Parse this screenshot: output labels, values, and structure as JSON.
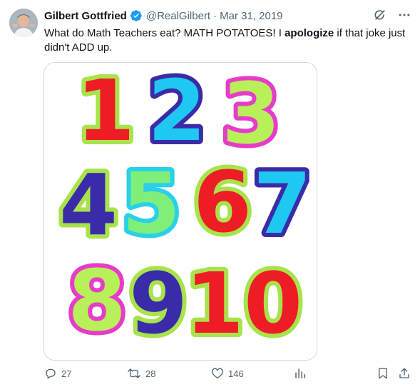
{
  "tweet": {
    "author_name": "Gilbert Gottfried",
    "handle": "@RealGilbert",
    "separator": "·",
    "date": "Mar 31, 2019",
    "text_part1": "What do Math Teachers eat?  MATH POTATOES! I ",
    "text_bold": "apologize",
    "text_part2": " if that joke just didn't ADD up."
  },
  "image": {
    "numbers": [
      "1",
      "2",
      "3",
      "4",
      "5",
      "6",
      "7",
      "8",
      "9",
      "10"
    ]
  },
  "actions": {
    "replies": "27",
    "retweets": "28",
    "likes": "146"
  },
  "colors": {
    "verified": "#1d9bf0",
    "muted": "#536471",
    "text": "#0f1419"
  },
  "icons": [
    "verified-badge-icon",
    "grok-icon",
    "more-icon",
    "reply-icon",
    "retweet-icon",
    "like-icon",
    "views-icon",
    "bookmark-icon",
    "share-icon"
  ]
}
